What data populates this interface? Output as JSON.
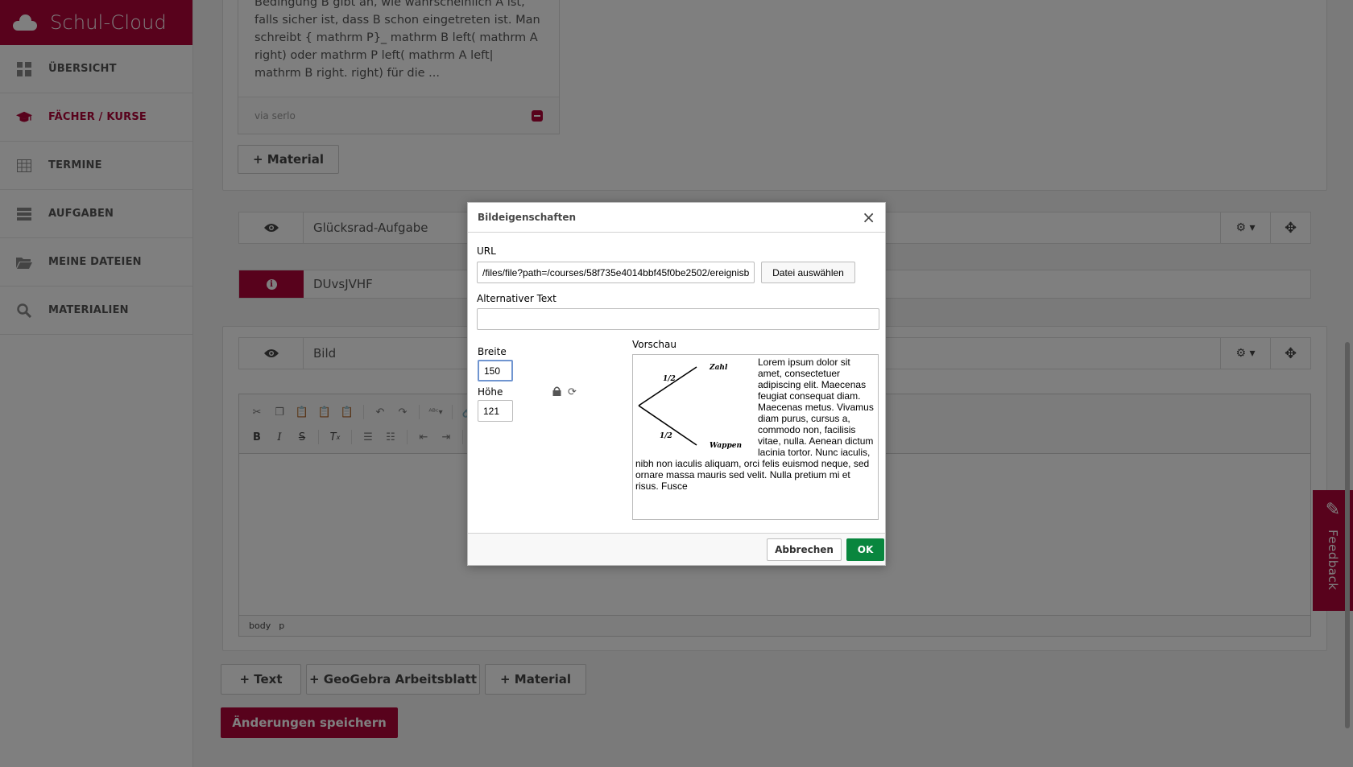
{
  "brand": {
    "title": "Schul-Cloud"
  },
  "sidebar": {
    "items": [
      {
        "label": "ÜBERSICHT",
        "icon": "dashboard-icon"
      },
      {
        "label": "FÄCHER / KURSE",
        "icon": "graduation-cap-icon",
        "active": true
      },
      {
        "label": "TERMINE",
        "icon": "calendar-icon"
      },
      {
        "label": "AUFGABEN",
        "icon": "tasks-icon"
      },
      {
        "label": "MEINE DATEIEN",
        "icon": "folder-icon"
      },
      {
        "label": "MATERIALIEN",
        "icon": "search-icon"
      }
    ]
  },
  "content_card": {
    "text": "Bedingung B gibt an, wie wahrscheinlich A ist, falls sicher ist, dass B schon eingetreten ist. Man schreibt { mathrm P}_ mathrm B left( mathrm A right) oder mathrm P left( mathrm A left| mathrm B right. right) für die ...",
    "source": "via serlo"
  },
  "add_material_top": "+ Material",
  "gluecksrad": {
    "title": "Glücksrad-Aufgabe"
  },
  "info_row": {
    "title": "DUvsJVHF"
  },
  "bild": {
    "title": "Bild"
  },
  "editor": {
    "path": [
      "body",
      "p"
    ]
  },
  "bottom_buttons": {
    "text": "+ Text",
    "geogebra": "+ GeoGebra Arbeitsblatt",
    "material": "+ Material"
  },
  "save_label": "Änderungen speichern",
  "feedback_label": "Feedback",
  "dialog": {
    "title": "Bildeigenschaften",
    "url_label": "URL",
    "url_value": "/files/file?path=/courses/58f735e4014bbf45f0be2502/ereignisb",
    "file_button": "Datei auswählen",
    "alt_label": "Alternativer Text",
    "alt_value": "",
    "width_label": "Breite",
    "width_value": "150",
    "height_label": "Höhe",
    "height_value": "121",
    "preview_label": "Vorschau",
    "preview_text": "Lorem ipsum dolor sit amet, consectetuer adipiscing elit. Maecenas feugiat consequat diam. Maecenas metus. Vivamus diam purus, cursus a, commodo non, facilisis vitae, nulla. Aenean dictum lacinia tortor. Nunc iaculis, nibh non iaculis aliquam, orci felis euismod neque, sed ornare massa mauris sed velit. Nulla pretium mi et risus. Fusce",
    "tree": {
      "top_prob": "1/2",
      "bottom_prob": "1/2",
      "top_label": "Zahl",
      "bottom_label": "Wappen"
    },
    "cancel": "Abbrechen",
    "ok": "OK"
  },
  "colors": {
    "brand": "#b10438",
    "ok": "#09863e"
  }
}
